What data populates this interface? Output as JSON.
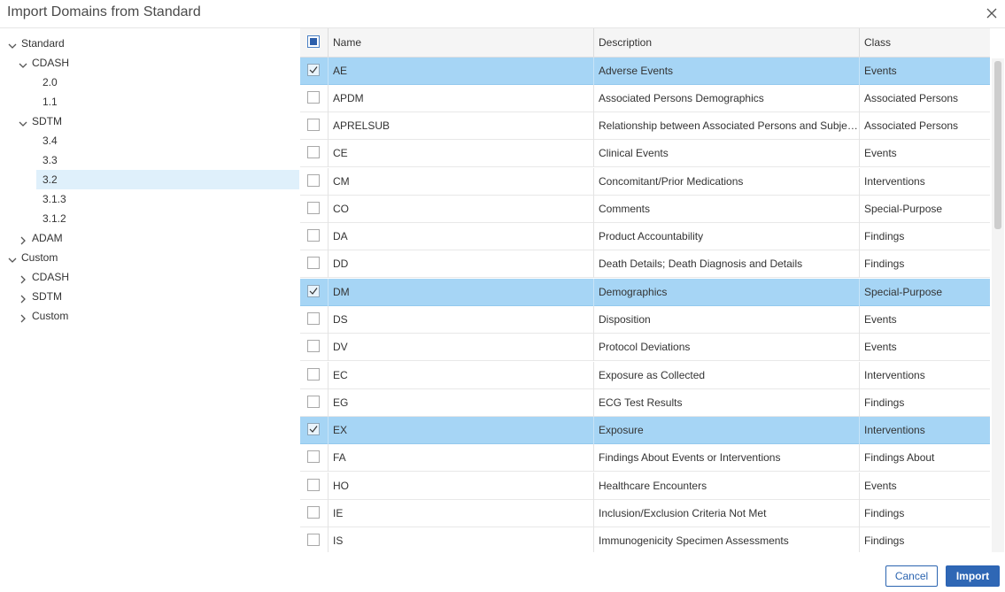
{
  "dialog": {
    "title": "Import Domains from Standard",
    "close_icon": "close-icon"
  },
  "tree": [
    {
      "label": "Standard",
      "level": 0,
      "expander": "down"
    },
    {
      "label": "CDASH",
      "level": 1,
      "expander": "down"
    },
    {
      "label": "2.0",
      "level": 2,
      "expander": "none"
    },
    {
      "label": "1.1",
      "level": 2,
      "expander": "none"
    },
    {
      "label": "SDTM",
      "level": 1,
      "expander": "down"
    },
    {
      "label": "3.4",
      "level": 2,
      "expander": "none"
    },
    {
      "label": "3.3",
      "level": 2,
      "expander": "none"
    },
    {
      "label": "3.2",
      "level": 2,
      "expander": "none",
      "selected": true
    },
    {
      "label": "3.1.3",
      "level": 2,
      "expander": "none"
    },
    {
      "label": "3.1.2",
      "level": 2,
      "expander": "none"
    },
    {
      "label": "ADAM",
      "level": 1,
      "expander": "right"
    },
    {
      "label": "Custom",
      "level": 0,
      "expander": "down"
    },
    {
      "label": "CDASH",
      "level": 1,
      "expander": "right"
    },
    {
      "label": "SDTM",
      "level": 1,
      "expander": "right"
    },
    {
      "label": "Custom",
      "level": 1,
      "expander": "right"
    }
  ],
  "grid": {
    "columns": {
      "name": "Name",
      "description": "Description",
      "class": "Class"
    },
    "header_checkbox": "indeterminate",
    "rows": [
      {
        "name": "AE",
        "description": "Adverse Events",
        "class": "Events",
        "checked": true
      },
      {
        "name": "APDM",
        "description": "Associated Persons Demographics",
        "class": "Associated Persons",
        "checked": false
      },
      {
        "name": "APRELSUB",
        "description": "Relationship between Associated Persons and Subjects",
        "class": "Associated Persons",
        "checked": false
      },
      {
        "name": "CE",
        "description": "Clinical Events",
        "class": "Events",
        "checked": false
      },
      {
        "name": "CM",
        "description": "Concomitant/Prior Medications",
        "class": "Interventions",
        "checked": false
      },
      {
        "name": "CO",
        "description": "Comments",
        "class": "Special-Purpose",
        "checked": false
      },
      {
        "name": "DA",
        "description": "Product Accountability",
        "class": "Findings",
        "checked": false
      },
      {
        "name": "DD",
        "description": "Death Details; Death Diagnosis and Details",
        "class": "Findings",
        "checked": false
      },
      {
        "name": "DM",
        "description": "Demographics",
        "class": "Special-Purpose",
        "checked": true
      },
      {
        "name": "DS",
        "description": "Disposition",
        "class": "Events",
        "checked": false
      },
      {
        "name": "DV",
        "description": "Protocol Deviations",
        "class": "Events",
        "checked": false
      },
      {
        "name": "EC",
        "description": "Exposure as Collected",
        "class": "Interventions",
        "checked": false
      },
      {
        "name": "EG",
        "description": "ECG Test Results",
        "class": "Findings",
        "checked": false
      },
      {
        "name": "EX",
        "description": "Exposure",
        "class": "Interventions",
        "checked": true
      },
      {
        "name": "FA",
        "description": "Findings About Events or Interventions",
        "class": "Findings About",
        "checked": false
      },
      {
        "name": "HO",
        "description": "Healthcare Encounters",
        "class": "Events",
        "checked": false
      },
      {
        "name": "IE",
        "description": "Inclusion/Exclusion Criteria Not Met",
        "class": "Findings",
        "checked": false
      },
      {
        "name": "IS",
        "description": "Immunogenicity Specimen Assessments",
        "class": "Findings",
        "checked": false
      }
    ]
  },
  "buttons": {
    "cancel": "Cancel",
    "import": "Import"
  },
  "colors": {
    "selected_row": "#a6d5f5",
    "tree_selected": "#dff0fb",
    "primary": "#2f67b5"
  }
}
